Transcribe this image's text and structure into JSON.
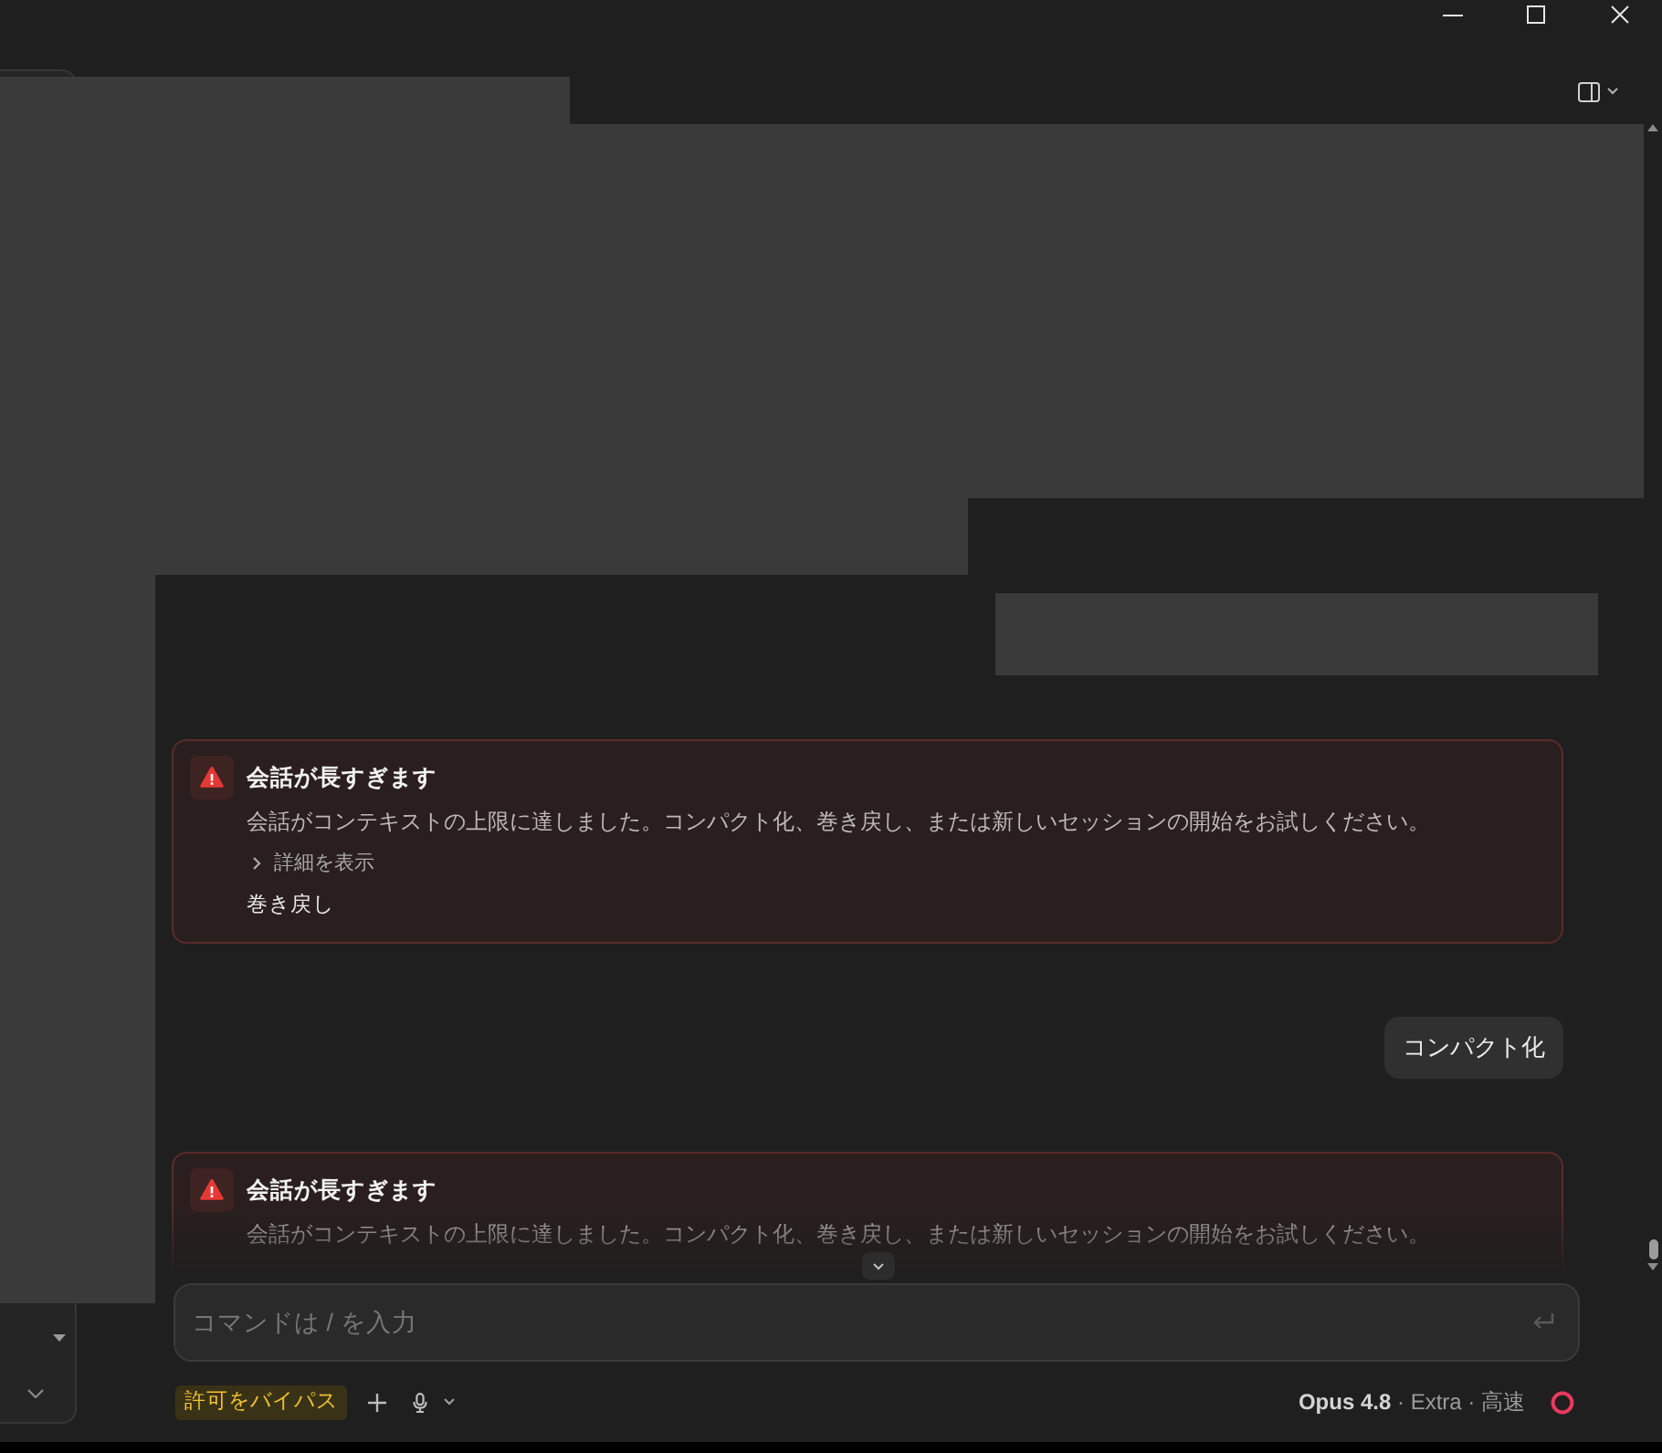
{
  "messages": [
    {
      "kind": "error",
      "title": "会話が長すぎます",
      "body": "会話がコンテキストの上限に達しました。コンパクト化、巻き戻し、または新しいセッションの開始をお試しください。",
      "details": {
        "label": "詳細を表示",
        "expanded": false
      },
      "action": "巻き戻し"
    },
    {
      "kind": "user",
      "text": "コンパクト化"
    },
    {
      "kind": "error",
      "title": "会話が長すぎます",
      "body": "会話がコンテキストの上限に達しました。コンパクト化、巻き戻し、または新しいセッションの開始をお試しください。"
    }
  ],
  "composer": {
    "placeholder": "コマンドは / を入力"
  },
  "footer": {
    "permission_mode": "許可をバイパス",
    "model": "**Opus 4.8** · Extra · 高速"
  }
}
